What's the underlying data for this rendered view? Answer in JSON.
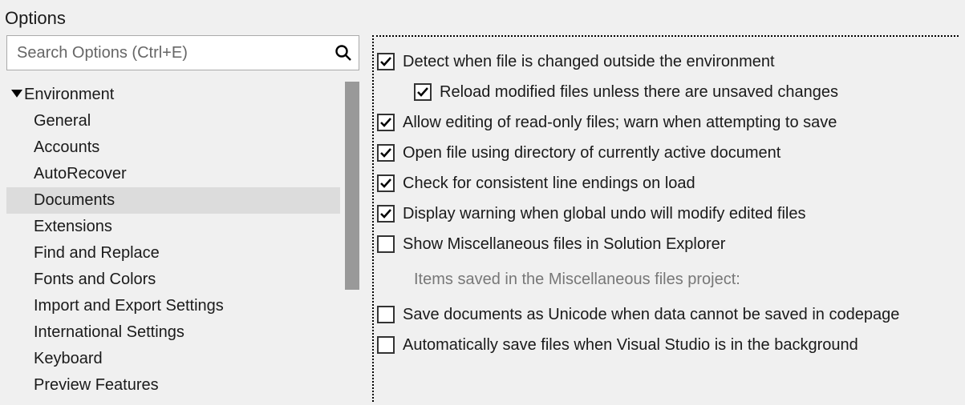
{
  "title": "Options",
  "search": {
    "placeholder": "Search Options (Ctrl+E)"
  },
  "tree": {
    "group_label": "Environment",
    "expanded": true,
    "items": [
      {
        "label": "General",
        "selected": false
      },
      {
        "label": "Accounts",
        "selected": false
      },
      {
        "label": "AutoRecover",
        "selected": false
      },
      {
        "label": "Documents",
        "selected": true
      },
      {
        "label": "Extensions",
        "selected": false
      },
      {
        "label": "Find and Replace",
        "selected": false
      },
      {
        "label": "Fonts and Colors",
        "selected": false
      },
      {
        "label": "Import and Export Settings",
        "selected": false
      },
      {
        "label": "International Settings",
        "selected": false
      },
      {
        "label": "Keyboard",
        "selected": false
      },
      {
        "label": "Preview Features",
        "selected": false
      }
    ]
  },
  "options": {
    "detect_changed": {
      "label": "Detect when file is changed outside the environment",
      "checked": true
    },
    "reload_modified": {
      "label": "Reload modified files unless there are unsaved changes",
      "checked": true
    },
    "allow_readonly": {
      "label": "Allow editing of read-only files; warn when attempting to save",
      "checked": true
    },
    "open_using_dir": {
      "label": "Open file using directory of currently active document",
      "checked": true
    },
    "check_line_endings": {
      "label": "Check for consistent line endings on load",
      "checked": true
    },
    "global_undo_warn": {
      "label": "Display warning when global undo will modify edited files",
      "checked": true
    },
    "show_misc": {
      "label": "Show Miscellaneous files in Solution Explorer",
      "checked": false
    },
    "misc_items_label": "Items saved in the Miscellaneous files project:",
    "save_unicode": {
      "label": "Save documents as Unicode when data cannot be saved in codepage",
      "checked": false
    },
    "autosave_bg": {
      "label": "Automatically save files when Visual Studio is in the background",
      "checked": false
    }
  }
}
